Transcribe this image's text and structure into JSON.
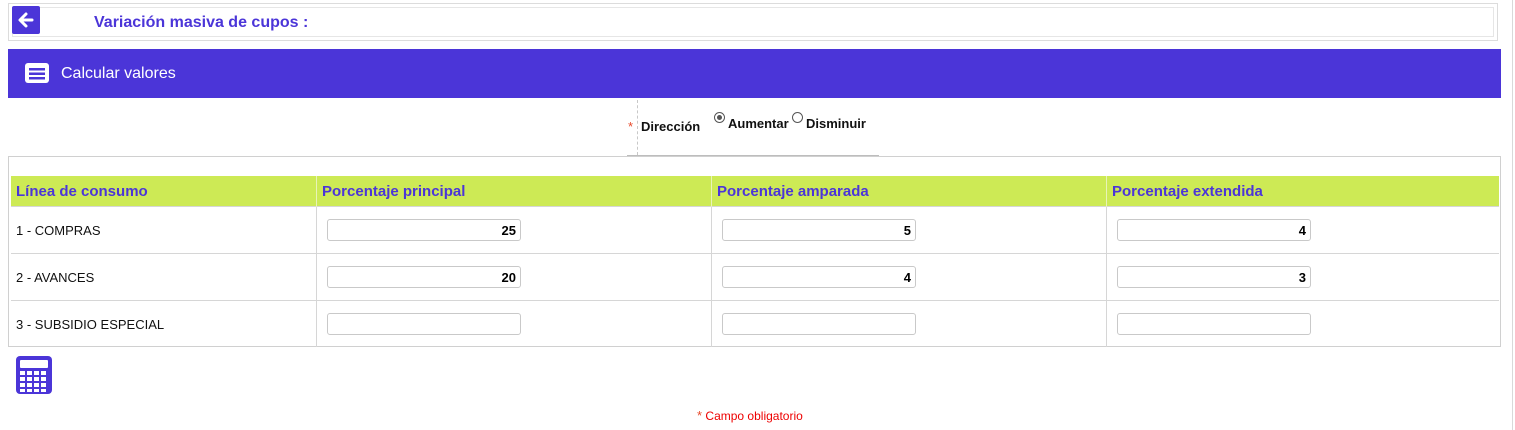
{
  "header": {
    "title": "Variación masiva de cupos :"
  },
  "section": {
    "title": "Calcular valores"
  },
  "direction": {
    "label": "Dirección",
    "options": [
      {
        "label": "Aumentar",
        "checked": true
      },
      {
        "label": "Disminuir",
        "checked": false
      }
    ]
  },
  "table": {
    "columns": [
      "Línea de consumo",
      "Porcentaje principal",
      "Porcentaje amparada",
      "Porcentaje extendida"
    ],
    "rows": [
      {
        "name": "1 - COMPRAS",
        "principal": "25",
        "amparada": "5",
        "extendida": "4"
      },
      {
        "name": "2 - AVANCES",
        "principal": "20",
        "amparada": "4",
        "extendida": "3"
      },
      {
        "name": "3 - SUBSIDIO ESPECIAL",
        "principal": "",
        "amparada": "",
        "extendida": ""
      }
    ]
  },
  "footer": {
    "required_star": "*",
    "required_note": "Campo obligatorio"
  },
  "colors": {
    "accent": "#4b35d8",
    "header_row": "#cdea55",
    "required": "#e00000"
  },
  "icons": {
    "back": "arrow-left-icon",
    "section": "card-list-icon",
    "calculate": "calculator-icon"
  }
}
